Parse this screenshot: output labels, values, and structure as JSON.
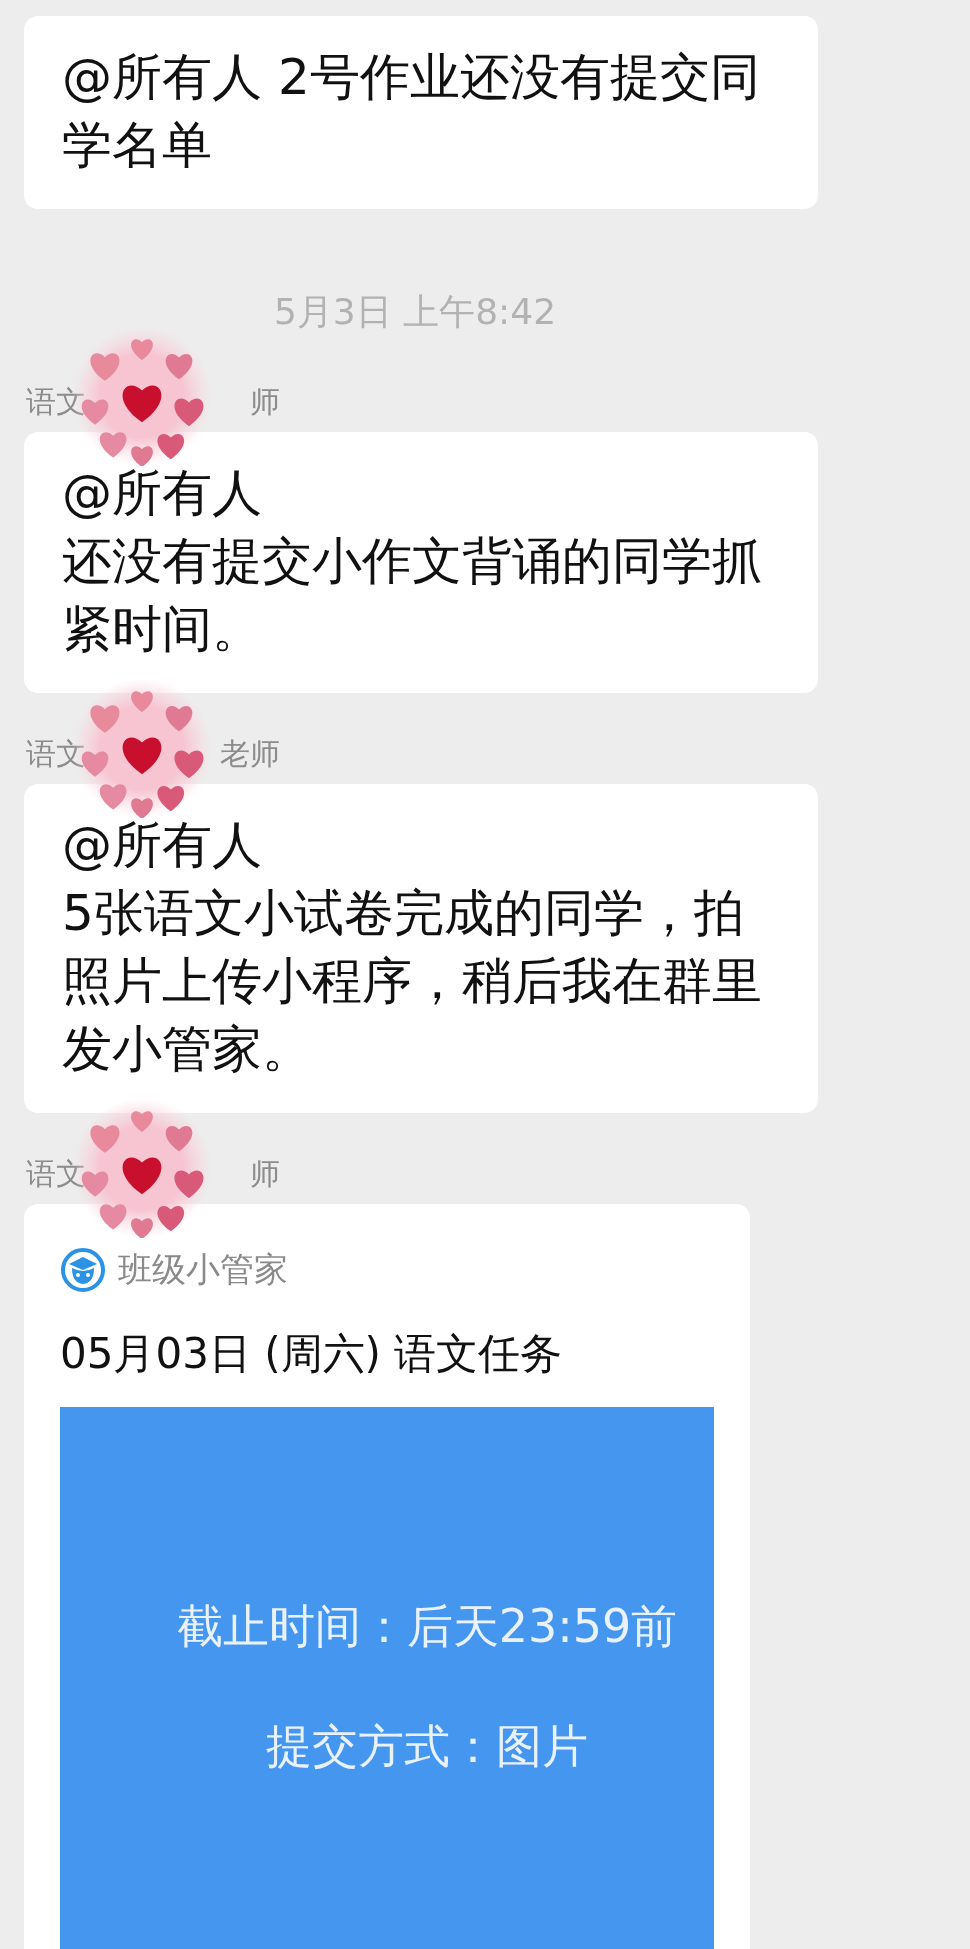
{
  "messages": [
    {
      "kind": "text",
      "text": "@所有人 2号作业还没有提交同学名单"
    },
    {
      "kind": "time",
      "text": "5月3日 上午8:42"
    },
    {
      "kind": "text",
      "sender": {
        "visible_start": "语文",
        "visible_end": "师",
        "covered_by_sticker": true
      },
      "mention": "@所有人",
      "text": "还没有提交小作文背诵的同学抓紧时间。"
    },
    {
      "kind": "text",
      "sender": {
        "visible_start": "语文",
        "visible_end": "老师",
        "covered_by_sticker": true
      },
      "mention": "@所有人",
      "text": "5张语文小试卷完成的同学，拍照片上传小程序，稍后我在群里发小管家。"
    },
    {
      "kind": "card",
      "sender": {
        "visible_start": "语文",
        "visible_end": "师",
        "covered_by_sticker": true
      },
      "app_name": "班级小管家",
      "title": "05月03日 (周六) 语文任务",
      "image_lines": [
        "截止时间：后天23:59前",
        "提交方式：图片"
      ]
    }
  ]
}
